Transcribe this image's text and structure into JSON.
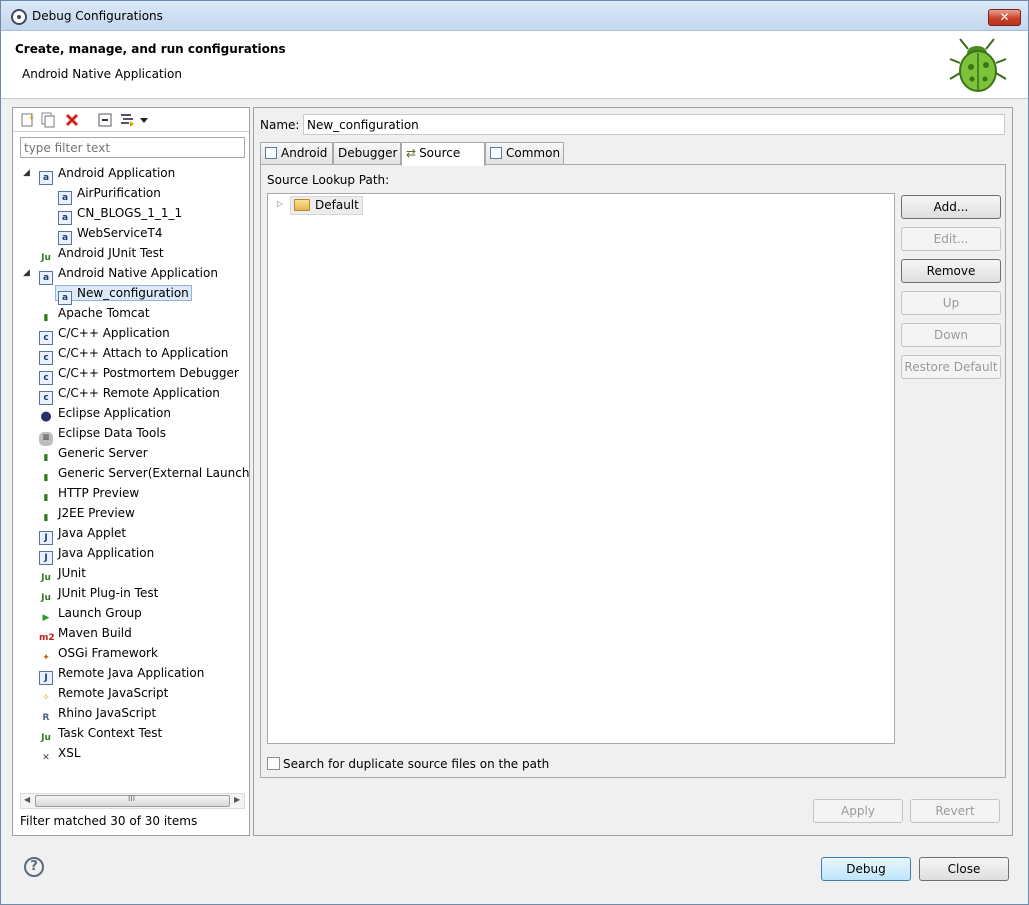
{
  "window": {
    "title": "Debug Configurations",
    "close_label": "✕"
  },
  "header": {
    "title": "Create, manage, and run configurations",
    "subtitle": "Android Native Application"
  },
  "left": {
    "filter_placeholder": "type filter text",
    "tree": [
      {
        "label": "Android Application",
        "icon": "android-app-icon",
        "glyph": "a"
      },
      {
        "label": "AirPurification",
        "icon": "android-app-icon",
        "glyph": "a"
      },
      {
        "label": "CN_BLOGS_1_1_1",
        "icon": "android-app-icon",
        "glyph": "a"
      },
      {
        "label": "WebServiceT4",
        "icon": "android-app-icon",
        "glyph": "a"
      },
      {
        "label": "Android JUnit Test",
        "icon": "junit-icon",
        "glyph": "Ju"
      },
      {
        "label": "Android Native Application",
        "icon": "android-app-icon",
        "glyph": "a"
      },
      {
        "label": "New_configuration",
        "icon": "android-app-icon",
        "glyph": "a"
      },
      {
        "label": "Apache Tomcat",
        "icon": "server-icon",
        "glyph": "▮"
      },
      {
        "label": "C/C++ Application",
        "icon": "c-app-icon",
        "glyph": "c"
      },
      {
        "label": "C/C++ Attach to Application",
        "icon": "c-app-icon",
        "glyph": "c"
      },
      {
        "label": "C/C++ Postmortem Debugger",
        "icon": "c-app-icon",
        "glyph": "c"
      },
      {
        "label": "C/C++ Remote Application",
        "icon": "c-app-icon",
        "glyph": "c"
      },
      {
        "label": "Eclipse Application",
        "icon": "eclipse-icon",
        "glyph": "●"
      },
      {
        "label": "Eclipse Data Tools",
        "icon": "database-icon",
        "glyph": "≡"
      },
      {
        "label": "Generic Server",
        "icon": "server-icon",
        "glyph": "▮"
      },
      {
        "label": "Generic Server(External Launch)",
        "icon": "server-icon",
        "glyph": "▮"
      },
      {
        "label": "HTTP Preview",
        "icon": "server-icon",
        "glyph": "▮"
      },
      {
        "label": "J2EE Preview",
        "icon": "server-icon",
        "glyph": "▮"
      },
      {
        "label": "Java Applet",
        "icon": "java-applet-icon",
        "glyph": "J"
      },
      {
        "label": "Java Application",
        "icon": "java-app-icon",
        "glyph": "J"
      },
      {
        "label": "JUnit",
        "icon": "junit-icon",
        "glyph": "Ju"
      },
      {
        "label": "JUnit Plug-in Test",
        "icon": "junit-icon",
        "glyph": "Ju"
      },
      {
        "label": "Launch Group",
        "icon": "launch-group-icon",
        "glyph": "▶"
      },
      {
        "label": "Maven Build",
        "icon": "maven-icon",
        "glyph": "m2"
      },
      {
        "label": "OSGi Framework",
        "icon": "osgi-icon",
        "glyph": "✦"
      },
      {
        "label": "Remote Java Application",
        "icon": "remote-java-icon",
        "glyph": "J"
      },
      {
        "label": "Remote JavaScript",
        "icon": "javascript-icon",
        "glyph": "✧"
      },
      {
        "label": "Rhino JavaScript",
        "icon": "rhino-icon",
        "glyph": "R"
      },
      {
        "label": "Task Context Test",
        "icon": "junit-icon",
        "glyph": "Ju"
      },
      {
        "label": "XSL",
        "icon": "xsl-icon",
        "glyph": "✕"
      }
    ],
    "filter_status": "Filter matched 30 of 30 items",
    "scroll_grip": "III"
  },
  "right": {
    "name_label": "Name:",
    "name_value": "New_configuration",
    "tabs": [
      "Android",
      "Debugger",
      "Source",
      "Common"
    ],
    "source_lookup_label": "Source Lookup Path:",
    "default_entry": "Default",
    "buttons": {
      "add": "Add...",
      "edit": "Edit...",
      "remove": "Remove",
      "up": "Up",
      "down": "Down",
      "restore": "Restore Default"
    },
    "dup_checkbox": "Search for duplicate source files on the path",
    "apply": "Apply",
    "revert": "Revert"
  },
  "footer": {
    "debug": "Debug",
    "close": "Close",
    "help": "?"
  },
  "colors": {
    "accent": "#3c7fb1",
    "selection": "#dce9f8",
    "close_button": "#c8432b",
    "error_red": "#d92020"
  }
}
